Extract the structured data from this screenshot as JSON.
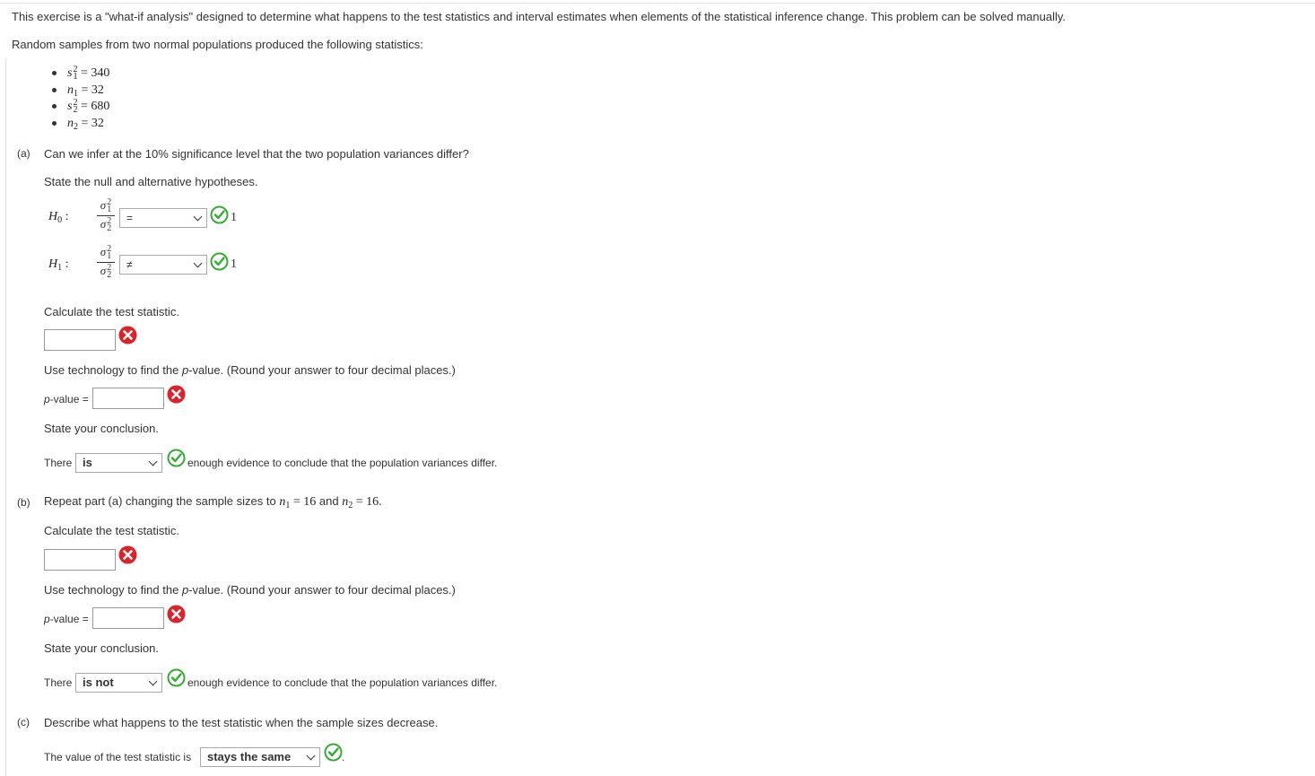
{
  "intro": "This exercise is a \"what-if analysis\" designed to determine what happens to the test statistics and interval estimates when elements of the statistical inference change. This problem can be solved manually.",
  "samples_text": "Random samples from two normal populations produced the following statistics:",
  "stats": [
    {
      "var": "s",
      "sup": "2",
      "sub": "1",
      "value": "= 340"
    },
    {
      "var": "n",
      "sub": "1",
      "value": "= 32"
    },
    {
      "var": "s",
      "sup": "2",
      "sub": "2",
      "value": "= 680"
    },
    {
      "var": "n",
      "sub": "2",
      "value": "= 32"
    }
  ],
  "part_a": {
    "label": "(a)",
    "question": "Can we infer at the 10% significance level that the two population variances differ?",
    "hyp_prompt": "State the null and alternative hypotheses.",
    "h0": {
      "name": "H",
      "sub": "0",
      "colon": ":",
      "num": "σ",
      "num_sup": "2",
      "num_sub": "1",
      "den": "σ",
      "den_sup": "2",
      "den_sub": "2",
      "select": "=",
      "points": "1"
    },
    "h1": {
      "name": "H",
      "sub": "1",
      "colon": ":",
      "num": "σ",
      "num_sup": "2",
      "num_sub": "1",
      "den": "σ",
      "den_sup": "2",
      "den_sub": "2",
      "select": "≠",
      "points": "1"
    },
    "calc_prompt": "Calculate the test statistic.",
    "test_stat_value": "",
    "pvalue_prompt_pre": "Use technology to find the ",
    "pvalue_prompt_italic": "p",
    "pvalue_prompt_post": "-value. (Round your answer to four decimal places.)",
    "pvalue_label_italic": "p",
    "pvalue_label_post": "-value =",
    "pvalue_value": "",
    "conclusion_prompt": "State your conclusion.",
    "conclusion_pre": "There",
    "conclusion_select": "is",
    "conclusion_post": "enough evidence to conclude that the population variances differ."
  },
  "part_b": {
    "label": "(b)",
    "question_pre": "Repeat part (a) changing the sample sizes to",
    "n1_var": "n",
    "n1_sub": "1",
    "n1_val": "= 16",
    "and": "and",
    "n2_var": "n",
    "n2_sub": "2",
    "n2_val": "= 16.",
    "calc_prompt": "Calculate the test statistic.",
    "test_stat_value": "",
    "pvalue_prompt_pre": "Use technology to find the ",
    "pvalue_prompt_italic": "p",
    "pvalue_prompt_post": "-value. (Round your answer to four decimal places.)",
    "pvalue_label_italic": "p",
    "pvalue_label_post": "-value =",
    "pvalue_value": "",
    "conclusion_prompt": "State your conclusion.",
    "conclusion_pre": "There",
    "conclusion_select": "is not",
    "conclusion_post": "enough evidence to conclude that the population variances differ."
  },
  "part_c": {
    "label": "(c)",
    "question": "Describe what happens to the test statistic when the sample sizes decrease.",
    "answer_pre": "The value of the test statistic is",
    "answer_select": "stays the same",
    "answer_post": "."
  },
  "colors": {
    "correct": "#3aa83a",
    "incorrect": "#d9242c",
    "text": "#333333"
  }
}
